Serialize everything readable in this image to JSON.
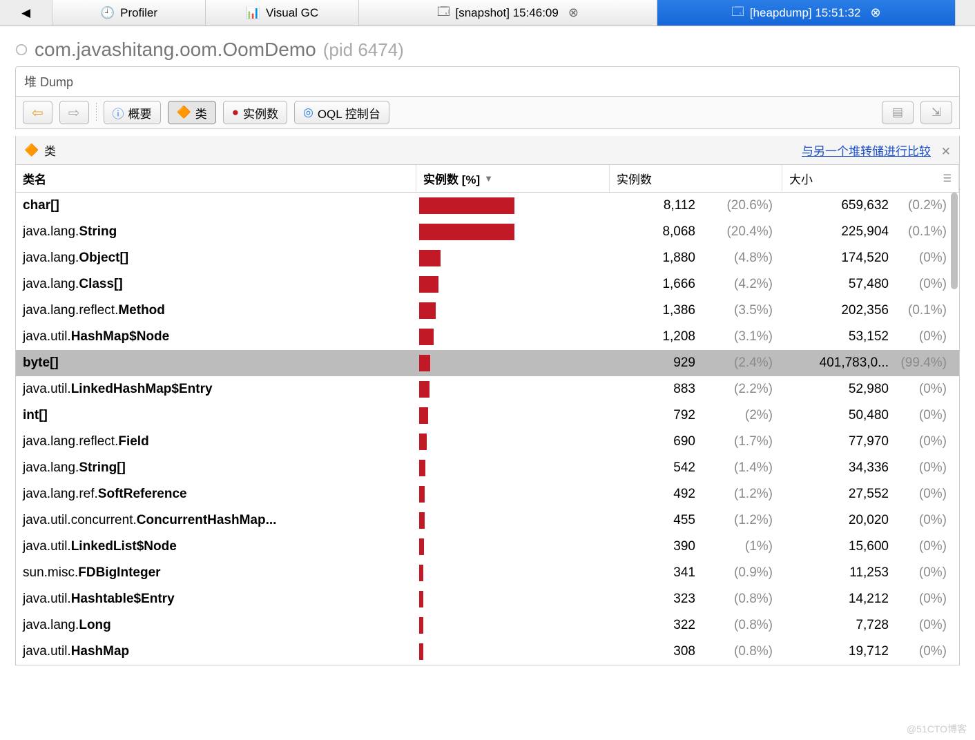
{
  "tabs": {
    "back_arrow": "◀",
    "profiler": "Profiler",
    "visualgc": "Visual GC",
    "snapshot": "[snapshot] 15:46:09",
    "heapdump": "[heapdump] 15:51:32"
  },
  "title": {
    "appname": "com.javashitang.oom.OomDemo",
    "pid": "(pid 6474)"
  },
  "dump_label": "堆 Dump",
  "toolbar": {
    "overview": "概要",
    "classes": "类",
    "instances": "实例数",
    "oql": "OQL 控制台"
  },
  "panel": {
    "label": "类",
    "compare_link": "与另一个堆转储进行比较"
  },
  "columns": {
    "name": "类名",
    "instances_pct": "实例数 [%]",
    "instances": "实例数",
    "size": "大小"
  },
  "rows": [
    {
      "prefix": "",
      "cls": "char[]",
      "bar": 22,
      "inst": "8,112",
      "pct": "(20.6%)",
      "size": "659,632",
      "spct": "(0.2%)",
      "selected": false
    },
    {
      "prefix": "java.lang.",
      "cls": "String",
      "bar": 22,
      "inst": "8,068",
      "pct": "(20.4%)",
      "size": "225,904",
      "spct": "(0.1%)",
      "selected": false
    },
    {
      "prefix": "java.lang.",
      "cls": "Object[]",
      "bar": 5,
      "inst": "1,880",
      "pct": "(4.8%)",
      "size": "174,520",
      "spct": "(0%)",
      "selected": false
    },
    {
      "prefix": "java.lang.",
      "cls": "Class[]",
      "bar": 4.5,
      "inst": "1,666",
      "pct": "(4.2%)",
      "size": "57,480",
      "spct": "(0%)",
      "selected": false
    },
    {
      "prefix": "java.lang.reflect.",
      "cls": "Method",
      "bar": 3.8,
      "inst": "1,386",
      "pct": "(3.5%)",
      "size": "202,356",
      "spct": "(0.1%)",
      "selected": false
    },
    {
      "prefix": "java.util.",
      "cls": "HashMap$Node",
      "bar": 3.3,
      "inst": "1,208",
      "pct": "(3.1%)",
      "size": "53,152",
      "spct": "(0%)",
      "selected": false
    },
    {
      "prefix": "",
      "cls": "byte[]",
      "bar": 2.6,
      "inst": "929",
      "pct": "(2.4%)",
      "size": "401,783,0...",
      "spct": "(99.4%)",
      "selected": true
    },
    {
      "prefix": "java.util.",
      "cls": "LinkedHashMap$Entry",
      "bar": 2.4,
      "inst": "883",
      "pct": "(2.2%)",
      "size": "52,980",
      "spct": "(0%)",
      "selected": false
    },
    {
      "prefix": "",
      "cls": "int[]",
      "bar": 2.1,
      "inst": "792",
      "pct": "(2%)",
      "size": "50,480",
      "spct": "(0%)",
      "selected": false
    },
    {
      "prefix": "java.lang.reflect.",
      "cls": "Field",
      "bar": 1.8,
      "inst": "690",
      "pct": "(1.7%)",
      "size": "77,970",
      "spct": "(0%)",
      "selected": false
    },
    {
      "prefix": "java.lang.",
      "cls": "String[]",
      "bar": 1.5,
      "inst": "542",
      "pct": "(1.4%)",
      "size": "34,336",
      "spct": "(0%)",
      "selected": false
    },
    {
      "prefix": "java.lang.ref.",
      "cls": "SoftReference",
      "bar": 1.3,
      "inst": "492",
      "pct": "(1.2%)",
      "size": "27,552",
      "spct": "(0%)",
      "selected": false
    },
    {
      "prefix": "java.util.concurrent.",
      "cls": "ConcurrentHashMap...",
      "bar": 1.3,
      "inst": "455",
      "pct": "(1.2%)",
      "size": "20,020",
      "spct": "(0%)",
      "selected": false
    },
    {
      "prefix": "java.util.",
      "cls": "LinkedList$Node",
      "bar": 1.1,
      "inst": "390",
      "pct": "(1%)",
      "size": "15,600",
      "spct": "(0%)",
      "selected": false
    },
    {
      "prefix": "sun.misc.",
      "cls": "FDBigInteger",
      "bar": 1.0,
      "inst": "341",
      "pct": "(0.9%)",
      "size": "11,253",
      "spct": "(0%)",
      "selected": false
    },
    {
      "prefix": "java.util.",
      "cls": "Hashtable$Entry",
      "bar": 0.9,
      "inst": "323",
      "pct": "(0.8%)",
      "size": "14,212",
      "spct": "(0%)",
      "selected": false
    },
    {
      "prefix": "java.lang.",
      "cls": "Long",
      "bar": 0.9,
      "inst": "322",
      "pct": "(0.8%)",
      "size": "7,728",
      "spct": "(0%)",
      "selected": false
    },
    {
      "prefix": "java.util.",
      "cls": "HashMap",
      "bar": 0.9,
      "inst": "308",
      "pct": "(0.8%)",
      "size": "19,712",
      "spct": "(0%)",
      "selected": false
    }
  ],
  "watermark": "@51CTO博客"
}
